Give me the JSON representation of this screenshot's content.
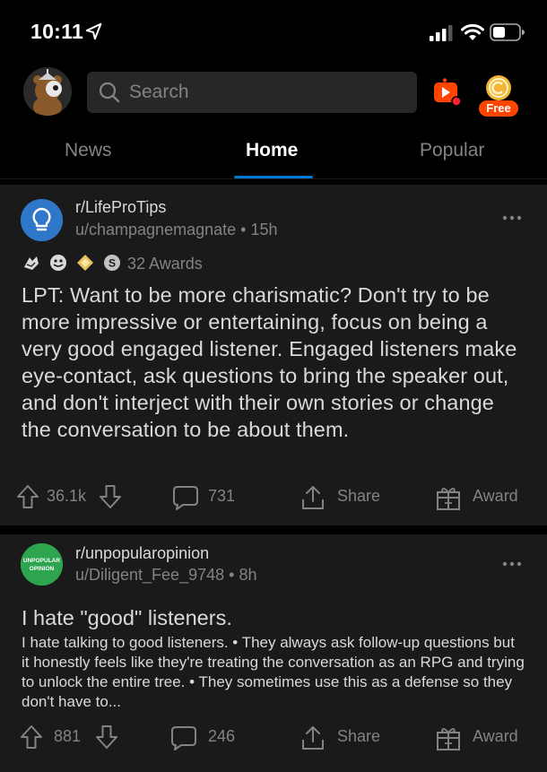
{
  "status_bar": {
    "time": "10:11"
  },
  "search": {
    "placeholder": "Search"
  },
  "coin": {
    "label": "Free"
  },
  "tabs": [
    {
      "label": "News"
    },
    {
      "label": "Home",
      "active": true
    },
    {
      "label": "Popular"
    }
  ],
  "posts": [
    {
      "subreddit": "r/LifeProTips",
      "author": "u/champagnemagnate",
      "separator": "•",
      "age": "15h",
      "awards_label": "32 Awards",
      "title": "LPT: Want to be more charismatic? Don't try to be more impressive or entertaining, focus on being a very good engaged listener. Engaged listeners make eye-contact, ask questions to bring the speaker out, and don't interject with their own stories or change the conversation to be about them.",
      "votes": "36.1k",
      "comments": "731",
      "share_label": "Share",
      "award_label": "Award"
    },
    {
      "subreddit": "r/unpopularopinion",
      "icon_text_1": "UNPOPULAR",
      "icon_text_2": "OPINION",
      "author": "u/Diligent_Fee_9748",
      "separator": "•",
      "age": "8h",
      "title": "I hate \"good\" listeners.",
      "body": "I hate talking to good listeners. • They always ask follow-up questions but it honestly feels like they're treating the conversation as an RPG and trying to unlock the entire tree. • They sometimes use this as a defense so they don't have to...",
      "votes": "881",
      "comments": "246",
      "share_label": "Share",
      "award_label": "Award"
    }
  ],
  "colors": {
    "background": "#000000",
    "card": "#1a1a1b",
    "text": "#d7dadc",
    "meta": "#818384",
    "accent": "#0079d3",
    "brand": "#ff4500"
  },
  "icons": {
    "status": [
      "location-arrow-icon",
      "signal-icon",
      "wifi-icon",
      "battery-icon"
    ],
    "header": [
      "avatar",
      "search-icon",
      "live-video-icon",
      "coin-icon"
    ],
    "post": [
      "upvote-icon",
      "downvote-icon",
      "comment-icon",
      "share-icon",
      "award-gift-icon",
      "more-options-icon"
    ]
  }
}
